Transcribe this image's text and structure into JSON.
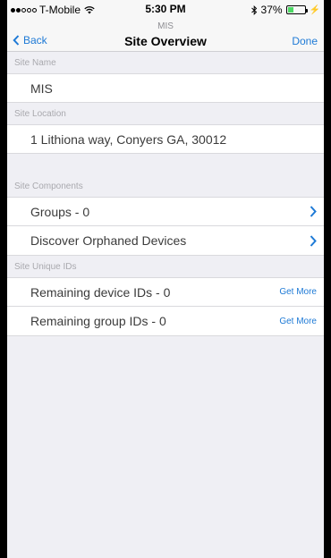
{
  "status": {
    "carrier": "T-Mobile",
    "time": "5:30 PM",
    "battery": "37%",
    "battery_level": 0.37
  },
  "nav": {
    "back_label": "Back",
    "subtitle": "MIS",
    "title": "Site Overview",
    "done_label": "Done"
  },
  "site_name": {
    "header": "Site Name",
    "value": "MIS"
  },
  "site_location": {
    "header": "Site Location",
    "value": "1 Lithiona way, Conyers GA, 30012"
  },
  "site_components": {
    "header": "Site Components",
    "items": [
      {
        "label": "Groups - 0"
      },
      {
        "label": "Discover Orphaned Devices"
      }
    ]
  },
  "site_unique_ids": {
    "header": "Site Unique IDs",
    "items": [
      {
        "label": "Remaining device IDs - 0",
        "action": "Get More"
      },
      {
        "label": "Remaining group IDs - 0",
        "action": "Get More"
      }
    ]
  },
  "colors": {
    "accent": "#1e7ad6",
    "background": "#efeff4",
    "battery": "#4cd964"
  },
  "icons": {
    "back": "chevron-left-icon",
    "disclosure": "chevron-right-icon",
    "wifi": "wifi-icon",
    "bluetooth": "bluetooth-icon",
    "battery": "battery-icon"
  }
}
